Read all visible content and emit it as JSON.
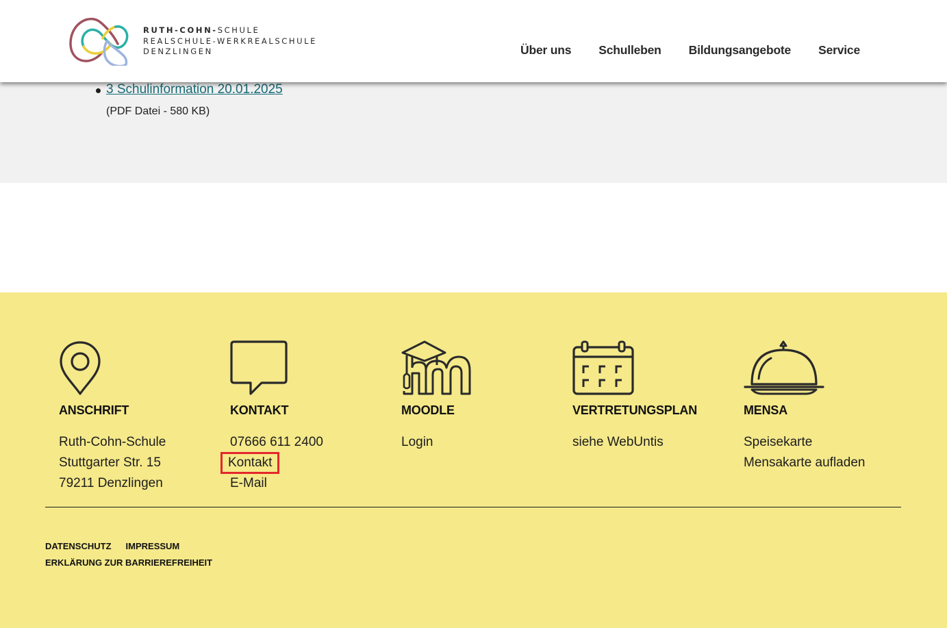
{
  "header": {
    "logo_line1_bold": "RUTH-COHN-",
    "logo_line1_rest": "SCHULE",
    "logo_line2": "REALSCHULE-WERKREALSCHULE",
    "logo_line3": "DENZLINGEN",
    "nav": [
      {
        "label": "Über uns"
      },
      {
        "label": "Schulleben"
      },
      {
        "label": "Bildungsangebote"
      },
      {
        "label": "Service"
      }
    ]
  },
  "content": {
    "document": {
      "link_text": "3 Schulinformation 20.01.2025",
      "meta": "(PDF Datei - 580 KB)"
    }
  },
  "footer": {
    "columns": [
      {
        "icon": "location-pin-icon",
        "title": "ANSCHRIFT",
        "lines": [
          "Ruth-Cohn-Schule",
          "Stuttgarter Str. 15",
          "79211 Denzlingen"
        ]
      },
      {
        "icon": "speech-bubble-icon",
        "title": "KONTAKT",
        "lines": [
          "07666 611 2400",
          "Kontakt",
          "E-Mail"
        ]
      },
      {
        "icon": "moodle-icon",
        "title": "MOODLE",
        "lines": [
          "Login"
        ]
      },
      {
        "icon": "calendar-icon",
        "title": "VERTRETUNGSPLAN",
        "lines": [
          "siehe WebUntis"
        ]
      },
      {
        "icon": "cloche-icon",
        "title": "MENSA",
        "lines": [
          "Speisekarte",
          "Mensakarte aufladen"
        ]
      }
    ],
    "legal": {
      "datenschutz": "DATENSCHUTZ",
      "impressum": "IMPRESSUM",
      "barrierefreiheit": "ERKLÄRUNG ZUR BARRIEREFREIHEIT"
    }
  },
  "colors": {
    "footer_bg": "#f5e98a",
    "content_bg": "#f1f1f1",
    "link": "#176b77",
    "highlight": "#e4262b"
  }
}
